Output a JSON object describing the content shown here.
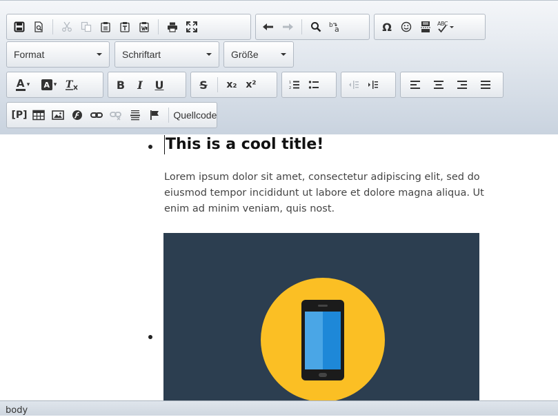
{
  "toolbar": {
    "row1": {
      "group1": [
        "save-icon",
        "preview-icon",
        "cut-icon",
        "copy-icon",
        "paste-icon",
        "paste-text-icon",
        "paste-word-icon",
        "print-icon",
        "maximize-icon"
      ],
      "group2": [
        "undo-icon",
        "redo-icon",
        "find-icon",
        "replace-icon"
      ],
      "group3": [
        "special-char-icon",
        "smiley-icon",
        "page-break-icon",
        "spellcheck-icon"
      ],
      "spellcheck_text": "ABC"
    },
    "format_label": "Format",
    "font_label": "Schriftart",
    "size_label": "Größe",
    "row3": {
      "text_color_letter": "A",
      "bg_color_letter": "A",
      "bold": "B",
      "italic": "I",
      "underline": "U",
      "strike": "S",
      "subscript": "x₂",
      "superscript": "x²"
    },
    "row4": {
      "paragraph": "[P]",
      "source_label": "Quellcode"
    },
    "colors": {
      "accent_underline": "#333333",
      "disabled": "#b5bbc2"
    }
  },
  "content": {
    "title": "This is a cool title!",
    "paragraph": "Lorem ipsum dolor sit amet, consectetur adipiscing elit, sed do eiusmod tempor incididunt ut labore et dolore magna aliqua. Ut enim ad minim veniam, quis nost.",
    "image": {
      "icon": "smartphone-icon",
      "background": "#2c3e50",
      "circle": "#fbbf24"
    }
  },
  "statusbar": {
    "path": "body"
  }
}
